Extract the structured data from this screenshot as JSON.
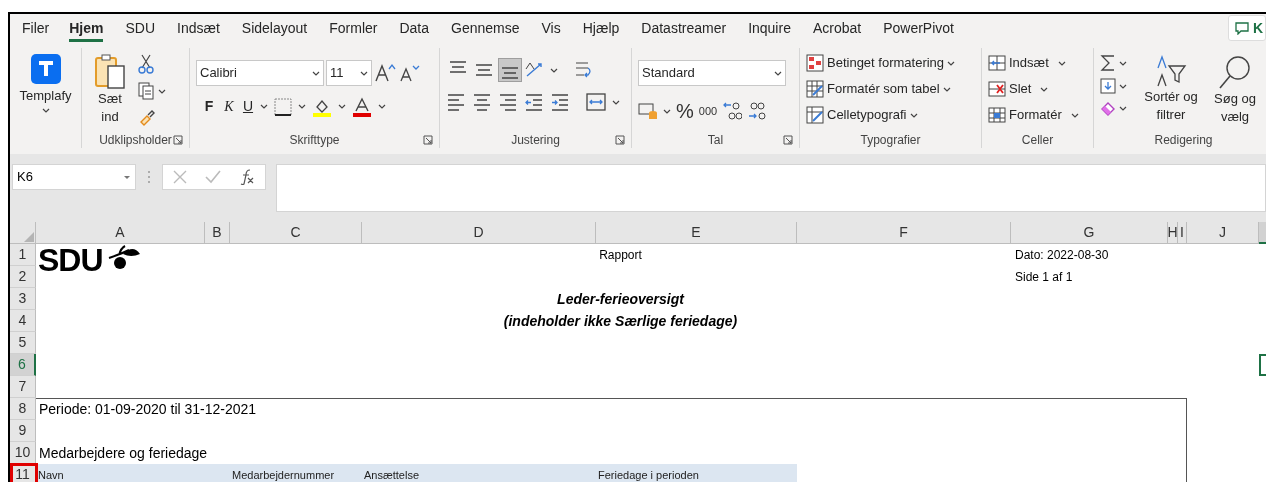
{
  "tabs": [
    {
      "label": "Filer",
      "selected": false
    },
    {
      "label": "Hjem",
      "selected": true
    },
    {
      "label": "SDU",
      "selected": false
    },
    {
      "label": "Indsæt",
      "selected": false
    },
    {
      "label": "Sidelayout",
      "selected": false
    },
    {
      "label": "Formler",
      "selected": false
    },
    {
      "label": "Data",
      "selected": false
    },
    {
      "label": "Gennemse",
      "selected": false
    },
    {
      "label": "Vis",
      "selected": false
    },
    {
      "label": "Hjælp",
      "selected": false
    },
    {
      "label": "Datastreamer",
      "selected": false
    },
    {
      "label": "Inquire",
      "selected": false
    },
    {
      "label": "Acrobat",
      "selected": false
    },
    {
      "label": "PowerPivot",
      "selected": false
    }
  ],
  "comment_button": {
    "label": "K"
  },
  "ribbon": {
    "templafy": {
      "label": "Templafy"
    },
    "clipboard": {
      "paste_label": "Sæt ind",
      "group": "Udklipsholder"
    },
    "font": {
      "name": "Calibri",
      "size": "11",
      "bold": "F",
      "italic": "K",
      "underline": "U",
      "group": "Skrifttype"
    },
    "alignment": {
      "vertical": [
        {
          "selected": false
        },
        {
          "selected": false
        },
        {
          "selected": true
        }
      ],
      "group": "Justering"
    },
    "number": {
      "format": "Standard",
      "percent": "%",
      "thousands": "000",
      "group": "Tal"
    },
    "styles": {
      "items": [
        "Betinget formatering",
        "Formatér som tabel",
        "Celletypografi"
      ],
      "group": "Typografier"
    },
    "cells": {
      "items": [
        "Indsæt",
        "Slet",
        "Formatér"
      ],
      "group": "Celler"
    },
    "editing": {
      "items": [
        "Sortér og filtrer",
        "Søg og vælg"
      ],
      "group": "Redigering"
    }
  },
  "name_box": "K6",
  "columns": [
    {
      "label": "A",
      "selected": false
    },
    {
      "label": "B",
      "selected": false
    },
    {
      "label": "C",
      "selected": false
    },
    {
      "label": "D",
      "selected": false
    },
    {
      "label": "E",
      "selected": false
    },
    {
      "label": "F",
      "selected": false
    },
    {
      "label": "G",
      "selected": false
    },
    {
      "label": "H",
      "selected": false
    },
    {
      "label": "I",
      "selected": false
    },
    {
      "label": "J",
      "selected": false
    },
    {
      "selected": true
    }
  ],
  "rows": [
    {
      "label": "1",
      "selected": false
    },
    {
      "label": "2",
      "selected": false
    },
    {
      "label": "3",
      "selected": false
    },
    {
      "label": "4",
      "selected": false
    },
    {
      "label": "5",
      "selected": false
    },
    {
      "label": "6",
      "selected": true
    },
    {
      "label": "7",
      "selected": false
    },
    {
      "label": "8",
      "selected": false
    },
    {
      "label": "9",
      "selected": false
    },
    {
      "label": "10",
      "selected": false
    },
    {
      "label": "11",
      "selected": false
    }
  ],
  "sheet": {
    "logo": "SDU",
    "report_label": "Rapport",
    "date": "Dato: 2022-08-30",
    "page": "Side 1 af 1",
    "title": "Leder-ferieoversigt",
    "subtitle": "(indeholder ikke Særlige feriedage)",
    "period": "Periode: 01-09-2020 til 31-12-2021",
    "section": "Medarbejdere og feriedage",
    "table_headers": [
      "Navn",
      "Medarbejdernummer",
      "Ansættelse",
      "Feriedage i perioden"
    ]
  }
}
